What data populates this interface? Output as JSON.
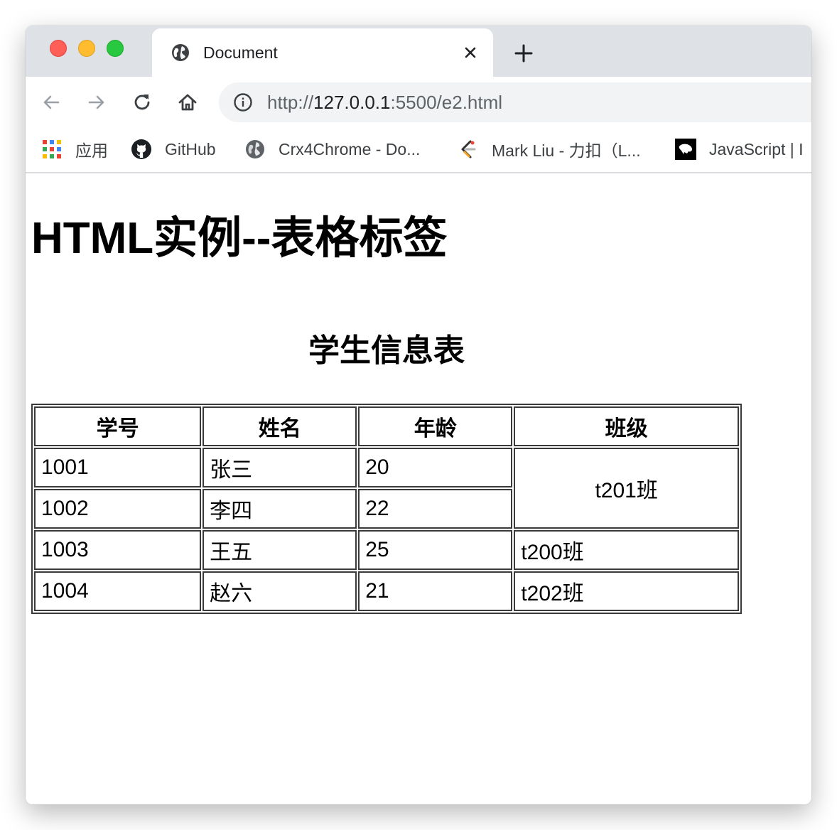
{
  "browser": {
    "tab_title": "Document",
    "url_scheme": "http://",
    "url_host": "127.0.0.1",
    "url_rest": ":5500/e2.html",
    "bookmarks": [
      {
        "label": "应用",
        "icon": "apps-grid-icon"
      },
      {
        "label": "GitHub",
        "icon": "github-icon"
      },
      {
        "label": "Crx4Chrome - Do...",
        "icon": "globe-icon"
      },
      {
        "label": "Mark Liu - 力扣（L...",
        "icon": "leetcode-icon"
      },
      {
        "label": "JavaScript | I",
        "icon": "js-site-icon"
      }
    ]
  },
  "page": {
    "heading": "HTML实例--表格标签",
    "table": {
      "caption": "学生信息表",
      "headers": [
        "学号",
        "姓名",
        "年龄",
        "班级"
      ],
      "rows": [
        {
          "id": "1001",
          "name": "张三",
          "age": "20",
          "class": "t201班"
        },
        {
          "id": "1002",
          "name": "李四",
          "age": "22"
        },
        {
          "id": "1003",
          "name": "王五",
          "age": "25",
          "class": "t200班"
        },
        {
          "id": "1004",
          "name": "赵六",
          "age": "21",
          "class": "t202班"
        }
      ]
    }
  },
  "colors": {
    "tabstrip": "#dee1e6",
    "omnibox": "#f1f3f4",
    "table_border": "#3a3a3a"
  }
}
